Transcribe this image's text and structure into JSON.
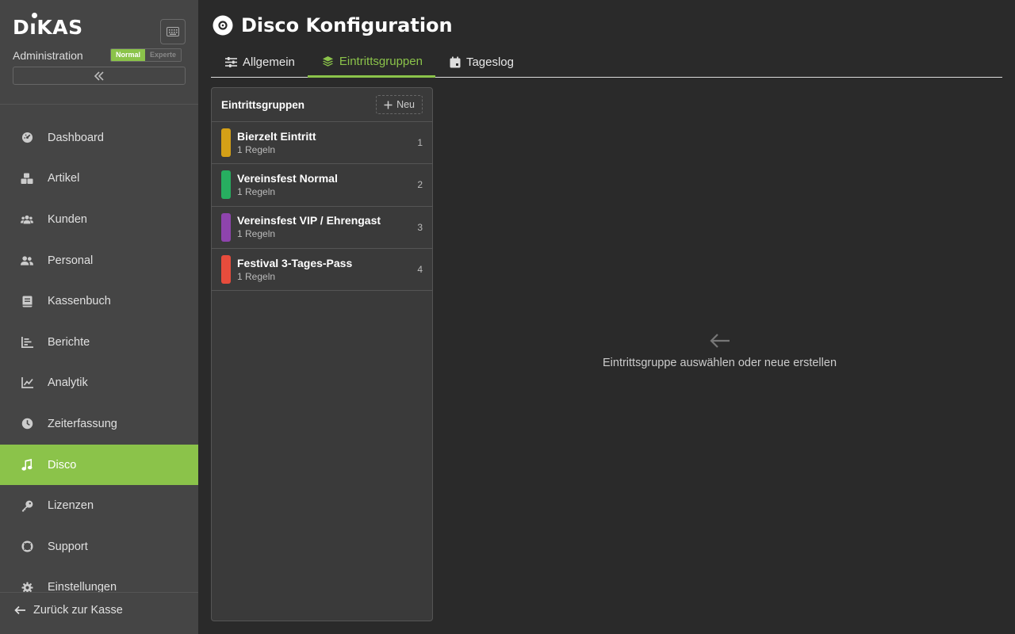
{
  "app": {
    "logo_text": "DIKAS",
    "subtitle": "Administration",
    "mode_normal": "Normal",
    "mode_expert": "Experte"
  },
  "sidebar": {
    "items": [
      {
        "label": "Dashboard",
        "icon": "dashboard-icon"
      },
      {
        "label": "Artikel",
        "icon": "boxes-icon"
      },
      {
        "label": "Kunden",
        "icon": "users-icon"
      },
      {
        "label": "Personal",
        "icon": "user-group-icon"
      },
      {
        "label": "Kassenbuch",
        "icon": "book-icon"
      },
      {
        "label": "Berichte",
        "icon": "bar-chart-icon"
      },
      {
        "label": "Analytik",
        "icon": "line-chart-icon"
      },
      {
        "label": "Zeiterfassung",
        "icon": "clock-icon"
      },
      {
        "label": "Disco",
        "icon": "music-icon",
        "active": true
      },
      {
        "label": "Lizenzen",
        "icon": "key-icon"
      },
      {
        "label": "Support",
        "icon": "lifebuoy-icon"
      },
      {
        "label": "Einstellungen",
        "icon": "gear-icon"
      }
    ],
    "back_label": "Zurück zur Kasse"
  },
  "header": {
    "title": "Disco Konfiguration"
  },
  "tabs": [
    {
      "label": "Allgemein",
      "icon": "sliders-icon"
    },
    {
      "label": "Eintrittsgruppen",
      "icon": "layers-icon",
      "active": true
    },
    {
      "label": "Tageslog",
      "icon": "calendar-icon"
    }
  ],
  "groups_panel": {
    "title": "Eintrittsgruppen",
    "new_label": "Neu",
    "groups": [
      {
        "name": "Bierzelt Eintritt",
        "rules": "1 Regeln",
        "number": "1",
        "color": "#d4a017"
      },
      {
        "name": "Vereinsfest Normal",
        "rules": "1 Regeln",
        "number": "2",
        "color": "#27ae60"
      },
      {
        "name": "Vereinsfest VIP / Ehrengast",
        "rules": "1 Regeln",
        "number": "3",
        "color": "#8e44ad"
      },
      {
        "name": "Festival 3-Tages-Pass",
        "rules": "1 Regeln",
        "number": "4",
        "color": "#e74c3c"
      }
    ]
  },
  "empty_state": {
    "text": "Eintrittsgruppe auswählen oder neue erstellen"
  },
  "colors": {
    "accent": "#8bc34a",
    "sidebar_bg": "#454545",
    "main_bg": "#2a2a2a"
  }
}
